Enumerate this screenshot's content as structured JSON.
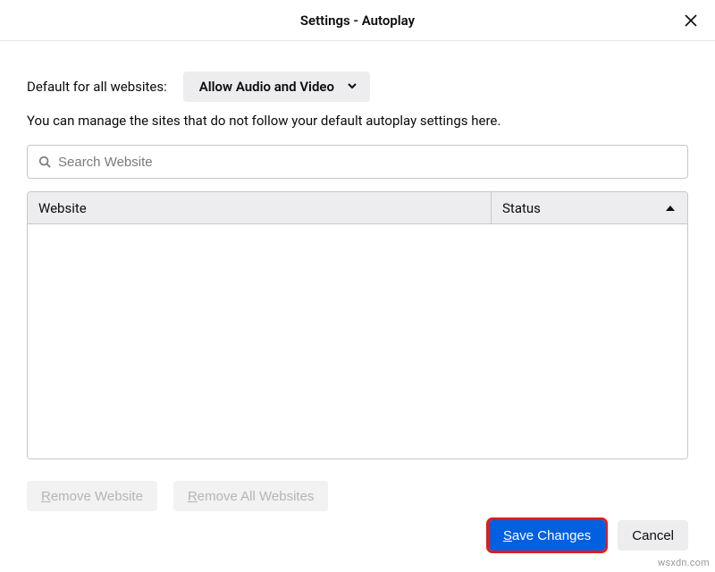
{
  "dialog": {
    "title": "Settings - Autoplay",
    "default_label": "Default for all websites:",
    "default_value": "Allow Audio and Video",
    "description": "You can manage the sites that do not follow your default autoplay settings here.",
    "search_placeholder": "Search Website"
  },
  "table": {
    "col_website": "Website",
    "col_status": "Status",
    "rows": []
  },
  "buttons": {
    "remove_website_prefix": "R",
    "remove_website_suffix": "emove Website",
    "remove_all_prefix": "R",
    "remove_all_suffix": "emove All Websites",
    "save_prefix": "S",
    "save_suffix": "ave Changes",
    "cancel": "Cancel"
  },
  "watermark": "wsxdn.com"
}
